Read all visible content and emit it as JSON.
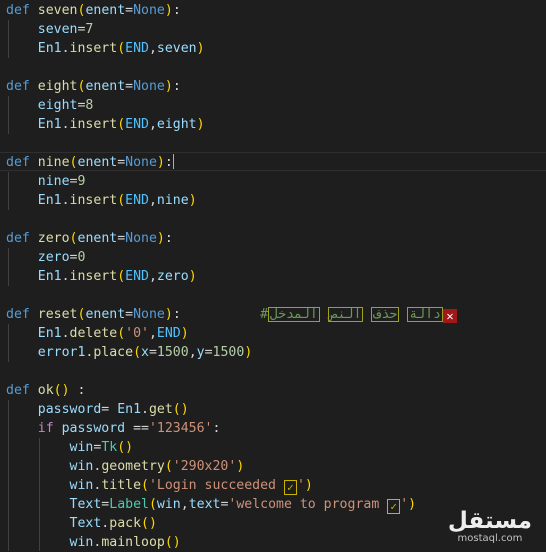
{
  "lines": {
    "l1": [
      "def",
      "seven",
      "(",
      "enent",
      "=",
      "None",
      ")",
      ":"
    ],
    "l2": [
      "seven",
      "=",
      "7"
    ],
    "l3": [
      "En1",
      ".",
      "insert",
      "(",
      "END",
      ",",
      "seven",
      ")"
    ],
    "l5": [
      "def",
      "eight",
      "(",
      "enent",
      "=",
      "None",
      ")",
      ":"
    ],
    "l6": [
      "eight",
      "=",
      "8"
    ],
    "l7": [
      "En1",
      ".",
      "insert",
      "(",
      "END",
      ",",
      "eight",
      ")"
    ],
    "l9": [
      "def",
      "nine",
      "(",
      "enent",
      "=",
      "None",
      ")",
      ":"
    ],
    "l10": [
      "nine",
      "=",
      "9"
    ],
    "l11": [
      "En1",
      ".",
      "insert",
      "(",
      "END",
      ",",
      "nine",
      ")"
    ],
    "l13": [
      "def",
      "zero",
      "(",
      "enent",
      "=",
      "None",
      ")",
      ":"
    ],
    "l14": [
      "zero",
      "=",
      "0"
    ],
    "l15": [
      "En1",
      ".",
      "insert",
      "(",
      "END",
      ",",
      "zero",
      ")"
    ],
    "l17": [
      "def",
      "reset",
      "(",
      "enent",
      "=",
      "None",
      ")",
      ":",
      "#",
      "المدخل",
      "النص",
      "حذف",
      "دالة"
    ],
    "l18": [
      "En1",
      ".",
      "delete",
      "(",
      "'0'",
      ",",
      "END",
      ")"
    ],
    "l19": [
      "error1",
      ".",
      "place",
      "(",
      "x",
      "=",
      "1500",
      ",",
      "y",
      "=",
      "1500",
      ")"
    ],
    "l21": [
      "def",
      "ok",
      "()",
      " :"
    ],
    "l22": [
      "password",
      "= ",
      "En1",
      ".",
      "get",
      "()"
    ],
    "l23": [
      "if",
      "password",
      " ==",
      "'123456'",
      ":"
    ],
    "l24": [
      "win",
      "=",
      "Tk",
      "()"
    ],
    "l25": [
      "win",
      ".",
      "geometry",
      "(",
      "'290x20'",
      ")"
    ],
    "l26": [
      "win",
      ".",
      "title",
      "(",
      "'Login succeeded ",
      "✓",
      "'",
      ")"
    ],
    "l27": [
      "Text",
      "=",
      "Label",
      "(",
      "win",
      ",",
      "text",
      "=",
      "'welcome to program ",
      "✓",
      "'",
      ")"
    ],
    "l28": [
      "Text",
      ".",
      "pack",
      "()"
    ],
    "l29": [
      "win",
      ".",
      "mainloop",
      "()"
    ]
  },
  "watermark": {
    "logo": "مستقل",
    "url": "mostaql.com"
  }
}
